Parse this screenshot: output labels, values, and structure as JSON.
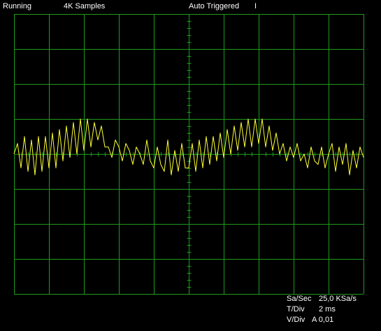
{
  "status_bar": {
    "run_state": "Running",
    "samples": "4K Samples",
    "trigger": "Auto Triggered",
    "trigger_marker": "I"
  },
  "colors": {
    "background": "#000000",
    "grid": "#1f9a1f",
    "trace": "#ffff33",
    "text": "#ffffff"
  },
  "grid": {
    "horizontal_divisions": 10,
    "vertical_divisions": 8
  },
  "readouts": {
    "sample_rate_label": "Sa/Sec",
    "sample_rate_value": "25,0 KSa/s",
    "time_div_label": "T/Div",
    "time_div_value": "2 ms",
    "volt_div_label": "V/Div",
    "volt_div_value": "A 0,01"
  },
  "chart_data": {
    "type": "line",
    "title": "",
    "xlabel": "",
    "ylabel": "",
    "xlim": [
      0,
      20
    ],
    "ylim": [
      -4,
      4
    ],
    "x_unit": "ms",
    "y_unit": "div",
    "grid": true,
    "series": [
      {
        "color": "#ffff33",
        "x": [
          0.0,
          0.2,
          0.4,
          0.6,
          0.8,
          1.0,
          1.2,
          1.4,
          1.6,
          1.8,
          2.0,
          2.2,
          2.4,
          2.6,
          2.8,
          3.0,
          3.2,
          3.4,
          3.6,
          3.8,
          4.0,
          4.2,
          4.4,
          4.6,
          4.8,
          5.0,
          5.2,
          5.4,
          5.6,
          5.8,
          6.0,
          6.2,
          6.4,
          6.6,
          6.8,
          7.0,
          7.2,
          7.4,
          7.6,
          7.8,
          8.0,
          8.2,
          8.4,
          8.6,
          8.8,
          9.0,
          9.2,
          9.4,
          9.6,
          9.8,
          10.0,
          10.2,
          10.4,
          10.6,
          10.8,
          11.0,
          11.2,
          11.4,
          11.6,
          11.8,
          12.0,
          12.2,
          12.4,
          12.6,
          12.8,
          13.0,
          13.2,
          13.4,
          13.6,
          13.8,
          14.0,
          14.2,
          14.4,
          14.6,
          14.8,
          15.0,
          15.2,
          15.4,
          15.6,
          15.8,
          16.0,
          16.2,
          16.4,
          16.6,
          16.8,
          17.0,
          17.2,
          17.4,
          17.6,
          17.8,
          18.0,
          18.2,
          18.4,
          18.6,
          18.8,
          19.0,
          19.2,
          19.4,
          19.6,
          19.8,
          20.0
        ],
        "values": [
          0.0,
          0.3,
          -0.4,
          0.5,
          -0.5,
          0.4,
          -0.6,
          0.5,
          -0.5,
          0.5,
          -0.4,
          0.6,
          -0.4,
          0.7,
          -0.2,
          0.8,
          -0.1,
          0.9,
          0.0,
          1.0,
          0.1,
          1.0,
          0.2,
          0.9,
          0.4,
          0.8,
          0.2,
          0.2,
          -0.1,
          0.4,
          0.2,
          -0.2,
          0.3,
          0.1,
          -0.3,
          0.2,
          0.0,
          -0.3,
          0.4,
          -0.2,
          -0.4,
          0.2,
          -0.3,
          -0.5,
          0.4,
          -0.6,
          0.1,
          -0.5,
          0.3,
          -0.4,
          -0.4,
          0.3,
          -0.5,
          0.4,
          -0.4,
          0.5,
          -0.3,
          0.5,
          -0.2,
          0.6,
          -0.1,
          0.7,
          0.0,
          0.8,
          0.1,
          0.9,
          0.2,
          1.0,
          0.2,
          1.0,
          0.3,
          1.0,
          0.2,
          0.8,
          0.1,
          0.6,
          0.0,
          0.3,
          -0.2,
          0.2,
          -0.1,
          0.3,
          -0.2,
          0.0,
          -0.4,
          0.2,
          -0.2,
          -0.3,
          0.2,
          -0.4,
          0.0,
          0.3,
          -0.5,
          0.2,
          -0.3,
          0.3,
          -0.6,
          0.1,
          -0.4,
          0.2,
          -0.1
        ]
      }
    ]
  }
}
